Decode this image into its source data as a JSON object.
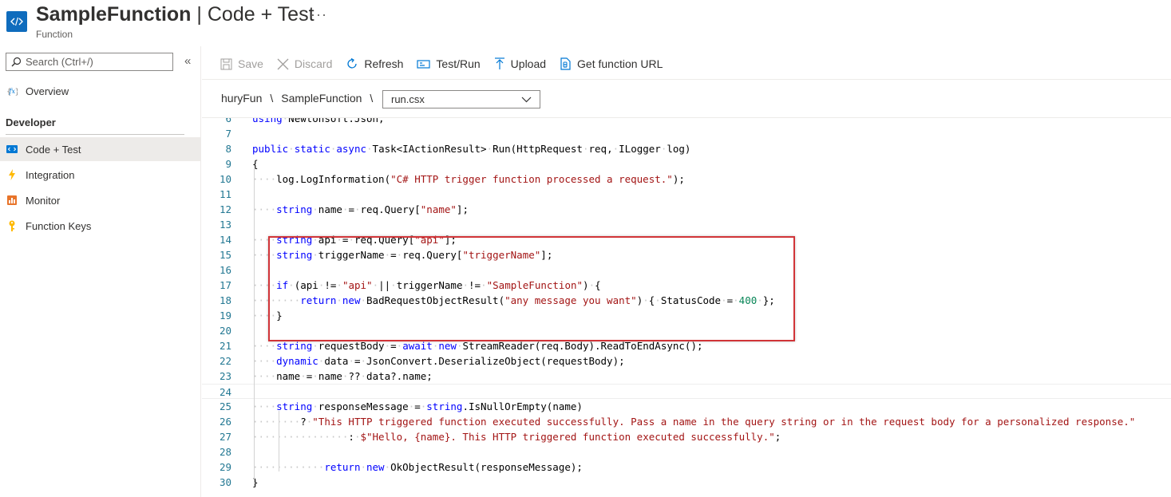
{
  "header": {
    "title_bold": "SampleFunction",
    "title_sep": " | ",
    "title_rest": "Code + Test",
    "more": "···",
    "subtitle": "Function"
  },
  "sidebar": {
    "search_placeholder": "Search (Ctrl+/)",
    "collapse": "«",
    "overview": "Overview",
    "section_developer": "Developer",
    "items": [
      {
        "label": "Code + Test",
        "icon": "code-icon",
        "active": true
      },
      {
        "label": "Integration",
        "icon": "lightning-icon",
        "active": false
      },
      {
        "label": "Monitor",
        "icon": "monitor-icon",
        "active": false
      },
      {
        "label": "Function Keys",
        "icon": "key-icon",
        "active": false
      }
    ]
  },
  "toolbar": {
    "save": "Save",
    "discard": "Discard",
    "refresh": "Refresh",
    "test_run": "Test/Run",
    "upload": "Upload",
    "get_url": "Get function URL"
  },
  "breadcrumb": {
    "app": "huryFun",
    "sep": "\\",
    "function": "SampleFunction",
    "sep2": "\\"
  },
  "file_select": {
    "value": "run.csx"
  },
  "editor": {
    "lines": [
      {
        "n": "6",
        "html": "using Newtonsoft.Json;"
      },
      {
        "n": "7",
        "html": ""
      },
      {
        "n": "8",
        "html": "public static async Task<IActionResult> Run(HttpRequest req, ILogger log)"
      },
      {
        "n": "9",
        "html": "{"
      },
      {
        "n": "10",
        "html": "    log.LogInformation(\"C# HTTP trigger function processed a request.\");"
      },
      {
        "n": "11",
        "html": ""
      },
      {
        "n": "12",
        "html": "    string name = req.Query[\"name\"];"
      },
      {
        "n": "13",
        "html": ""
      },
      {
        "n": "14",
        "html": "    string api = req.Query[\"api\"];"
      },
      {
        "n": "15",
        "html": "    string triggerName = req.Query[\"triggerName\"];"
      },
      {
        "n": "16",
        "html": ""
      },
      {
        "n": "17",
        "html": "    if (api != \"api\" || triggerName != \"SampleFunction\") {"
      },
      {
        "n": "18",
        "html": "        return new BadRequestObjectResult(\"any message you want\") { StatusCode = 400 };"
      },
      {
        "n": "19",
        "html": "    }"
      },
      {
        "n": "20",
        "html": ""
      },
      {
        "n": "21",
        "html": "    string requestBody = await new StreamReader(req.Body).ReadToEndAsync();"
      },
      {
        "n": "22",
        "html": "    dynamic data = JsonConvert.DeserializeObject(requestBody);"
      },
      {
        "n": "23",
        "html": "    name = name ?? data?.name;"
      },
      {
        "n": "24",
        "html": ""
      },
      {
        "n": "25",
        "html": "    string responseMessage = string.IsNullOrEmpty(name)"
      },
      {
        "n": "26",
        "html": "        ? \"This HTTP triggered function executed successfully. Pass a name in the query string or in the request body for a personalized response.\""
      },
      {
        "n": "27",
        "html": "                : $\"Hello, {name}. This HTTP triggered function executed successfully.\";"
      },
      {
        "n": "28",
        "html": ""
      },
      {
        "n": "29",
        "html": "            return new OkObjectResult(responseMessage);"
      },
      {
        "n": "30",
        "html": "}"
      }
    ]
  }
}
